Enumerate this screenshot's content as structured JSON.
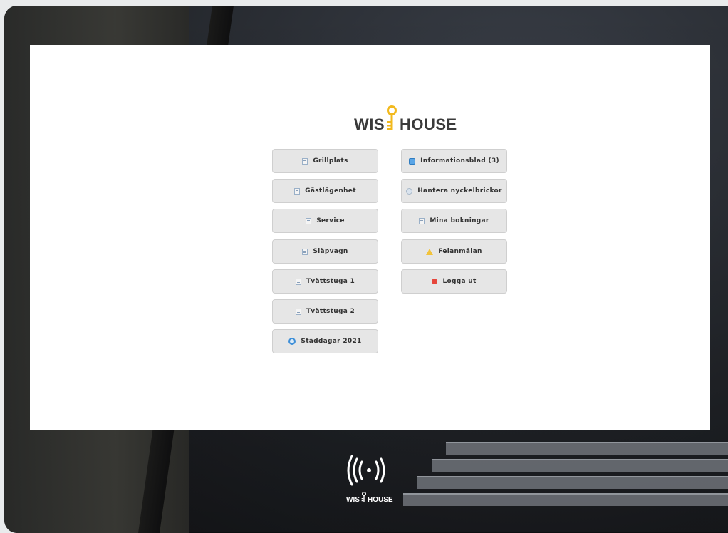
{
  "brand": {
    "name_left": "WIS",
    "name_right": "HOUSE",
    "key_color": "#f2b91d"
  },
  "menu_left": [
    {
      "label": "Grillplats",
      "icon": "document-icon"
    },
    {
      "label": "Gästlägenhet",
      "icon": "document-icon"
    },
    {
      "label": "Service",
      "icon": "document-icon"
    },
    {
      "label": "Släpvagn",
      "icon": "document-icon"
    },
    {
      "label": "Tvättstuga 1",
      "icon": "document-icon"
    },
    {
      "label": "Tvättstuga 2",
      "icon": "document-icon"
    },
    {
      "label": "Städdagar 2021",
      "icon": "cleaning-icon"
    }
  ],
  "menu_right": [
    {
      "label": "Informationsblad (3)",
      "icon": "info-sheet-icon"
    },
    {
      "label": "Hantera nyckelbrickor",
      "icon": "key-tag-icon"
    },
    {
      "label": "Mina bokningar",
      "icon": "document-icon"
    },
    {
      "label": "Felanmälan",
      "icon": "warning-icon"
    },
    {
      "label": "Logga ut",
      "icon": "logout-icon"
    }
  ],
  "footer_logo": {
    "name_left": "WIS",
    "name_right": "HOUSE"
  }
}
